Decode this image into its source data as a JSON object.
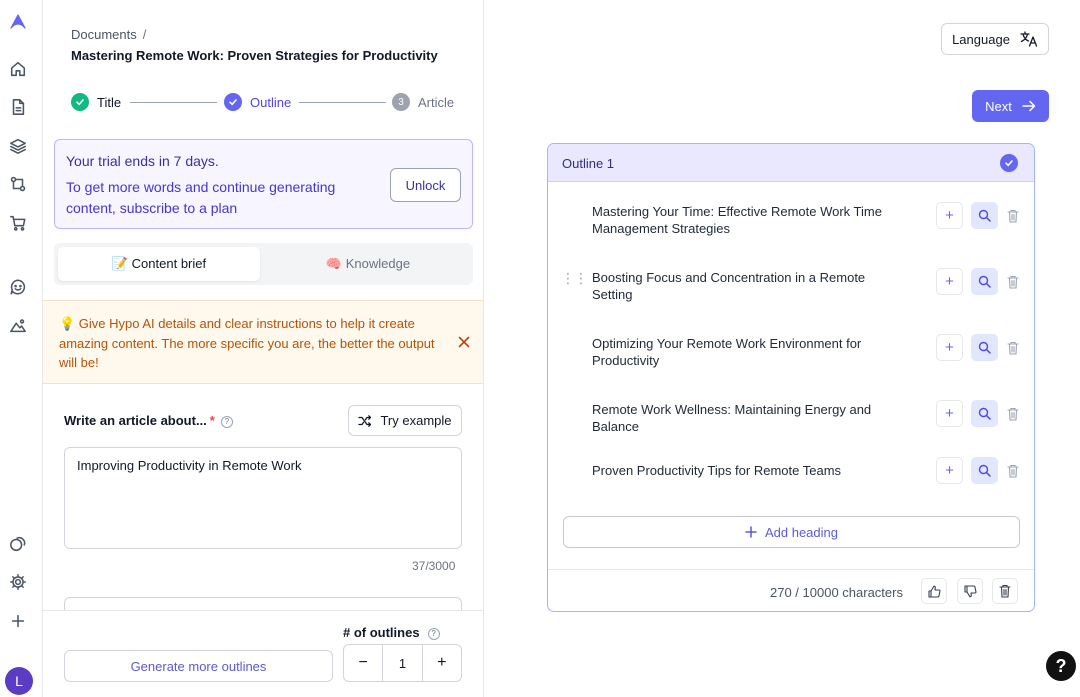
{
  "breadcrumb": {
    "root": "Documents",
    "separator": "/"
  },
  "document_title": "Mastering Remote Work: Proven Strategies for Productivity",
  "steps": [
    {
      "label": "Title",
      "state": "done"
    },
    {
      "label": "Outline",
      "state": "done"
    },
    {
      "label": "Article",
      "state": "pending",
      "number": "3"
    }
  ],
  "trial": {
    "heading": "Your trial ends in 7 days.",
    "message": "To get more words and continue generating content, subscribe to a plan",
    "unlock_label": "Unlock"
  },
  "tabs": [
    {
      "label": "📝 Content brief",
      "active": true
    },
    {
      "label": "🧠 Knowledge",
      "active": false
    }
  ],
  "tip": {
    "text": "💡 Give Hypo AI details and clear instructions to help it create amazing content. The more specific you are, the better the output will be!"
  },
  "form": {
    "prompt_label": "Write an article about...",
    "required_mark": "*",
    "try_example_label": "Try example",
    "prompt_value": "Improving Productivity in Remote Work",
    "char_count": "37/3000"
  },
  "footer": {
    "outlines_label": "# of outlines",
    "generate_label": "Generate more outlines",
    "outline_count": "1",
    "minus": "−",
    "plus": "+"
  },
  "toolbar": {
    "language_label": "Language",
    "next_label": "Next"
  },
  "outline": {
    "title": "Outline 1",
    "headings": [
      "Mastering Your Time: Effective Remote Work Time Management Strategies",
      "Boosting Focus and Concentration in a Remote Setting",
      "Optimizing Your Remote Work Environment for Productivity",
      "Remote Work Wellness: Maintaining Energy and Balance",
      "Proven Productivity Tips for Remote Teams"
    ],
    "add_heading_label": "Add heading",
    "character_count": "270 / 10000 characters"
  },
  "user": {
    "avatar_initial": "L"
  },
  "help_label": "?",
  "colors": {
    "accent": "#6366f1",
    "success": "#10b981",
    "tip_text": "#b45309"
  }
}
